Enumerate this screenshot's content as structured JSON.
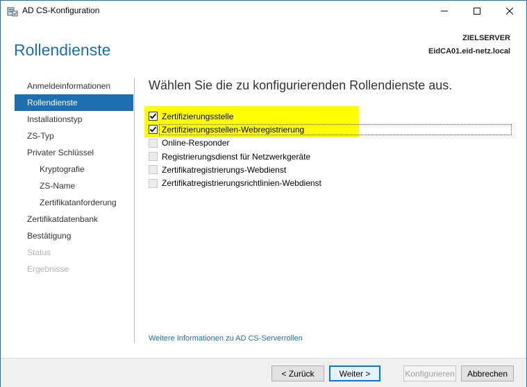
{
  "window": {
    "title": "AD CS-Konfiguration",
    "icon": "server-config-icon"
  },
  "header": {
    "page_title": "Rollendienste",
    "server_label": "ZIELSERVER",
    "server_name": "EidCA01.eid-netz.local"
  },
  "nav": {
    "items": [
      {
        "label": "Anmeldeinformationen",
        "state": "normal"
      },
      {
        "label": "Rollendienste",
        "state": "active"
      },
      {
        "label": "Installationstyp",
        "state": "normal"
      },
      {
        "label": "ZS-Typ",
        "state": "normal"
      },
      {
        "label": "Privater Schlüssel",
        "state": "normal"
      },
      {
        "label": "Kryptografie",
        "state": "sub"
      },
      {
        "label": "ZS-Name",
        "state": "sub"
      },
      {
        "label": "Zertifikatanforderung",
        "state": "sub"
      },
      {
        "label": "Zertifikatdatenbank",
        "state": "normal"
      },
      {
        "label": "Bestätigung",
        "state": "normal"
      },
      {
        "label": "Status",
        "state": "disabled"
      },
      {
        "label": "Ergebnisse",
        "state": "disabled"
      }
    ]
  },
  "content": {
    "heading": "Wählen Sie die zu konfigurierenden Rollendienste aus.",
    "services": [
      {
        "label": "Zertifizierungsstelle",
        "checked": true
      },
      {
        "label": "Zertifizierungsstellen-Webregistrierung",
        "checked": true
      },
      {
        "label": "Online-Responder",
        "checked": false
      },
      {
        "label": "Registrierungsdienst für Netzwerkgeräte",
        "checked": false
      },
      {
        "label": "Zertifikatregistrierungs-Webdienst",
        "checked": false
      },
      {
        "label": "Zertifikatregistrierungsrichtlinien-Webdienst",
        "checked": false
      }
    ],
    "more_link": "Weitere Informationen zu AD CS-Serverrollen"
  },
  "footer": {
    "back": "< Zurück",
    "next": "Weiter >",
    "configure": "Konfigurieren",
    "cancel": "Abbrechen"
  },
  "colors": {
    "accent": "#1e6fb0",
    "highlight": "#ffff00"
  }
}
